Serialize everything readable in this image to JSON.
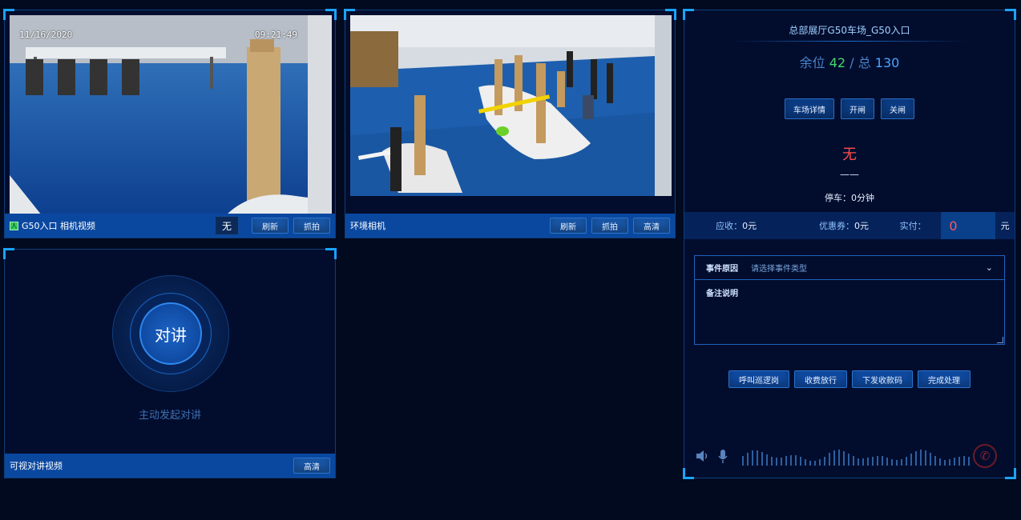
{
  "panels": {
    "entry_camera": {
      "title": "G50入口 相机视频",
      "plate": "无",
      "buttons": {
        "refresh": "刷新",
        "capture": "抓拍"
      },
      "overlay_date": "11/16/2020",
      "overlay_time": "09:21:49"
    },
    "env_camera": {
      "title": "环境相机",
      "buttons": {
        "refresh": "刷新",
        "capture": "抓拍",
        "hd": "高清"
      }
    },
    "intercom": {
      "title": "可视对讲视频",
      "talk_button": "对讲",
      "hint": "主动发起对讲",
      "buttons": {
        "hd": "高清"
      }
    }
  },
  "right_panel": {
    "title": "总部展厅G50车场_G50入口",
    "spaces": {
      "free_label": "余位",
      "free": "42",
      "sep": "/",
      "total_label": "总",
      "total": "130"
    },
    "buttons": {
      "details": "车场详情",
      "open": "开闸",
      "close": "关闸"
    },
    "plate": "无",
    "dash": "——",
    "parking_time": "停车：0分钟",
    "fees": {
      "due_label": "应收：",
      "due": "0元",
      "coupon_label": "优惠券：",
      "coupon": "0元",
      "paid_label": "实付：",
      "paid": "0",
      "unit": "元"
    },
    "form": {
      "event_label": "事件原因",
      "event_placeholder": "请选择事件类型",
      "note_label": "备注说明"
    },
    "actions": {
      "call_patrol": "呼叫巡逻岗",
      "charge_release": "收费放行",
      "send_code": "下发收款码",
      "complete": "完成处理"
    }
  },
  "colors": {
    "background": "#020a20",
    "accent": "#1aa3ff",
    "bar": "#0a48a0",
    "free_space": "#46d66a",
    "total_space": "#4ba4ff",
    "alert": "#ff4d4d"
  },
  "icons": [
    "speaker-icon",
    "microphone-icon",
    "hangup-icon",
    "chevron-down-icon",
    "camera-status-icon"
  ]
}
